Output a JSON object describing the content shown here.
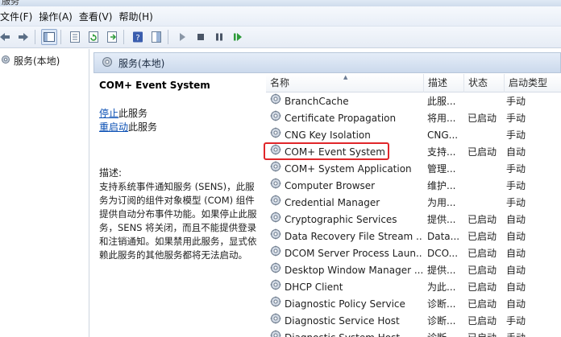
{
  "window": {
    "title": "服务"
  },
  "menu": [
    {
      "label": "文件(F)"
    },
    {
      "label": "操作(A)"
    },
    {
      "label": "查看(V)"
    },
    {
      "label": "帮助(H)"
    }
  ],
  "toolbar": [
    {
      "icon": "back-arrow-icon"
    },
    {
      "icon": "forward-arrow-icon"
    },
    {
      "icon": "show-hide-tree-icon"
    },
    {
      "icon": "properties-icon"
    },
    {
      "icon": "refresh-icon"
    },
    {
      "icon": "export-list-icon"
    },
    {
      "icon": "help-icon"
    },
    {
      "icon": "show-pane-icon"
    },
    {
      "icon": "start-service-icon"
    },
    {
      "icon": "stop-service-icon"
    },
    {
      "icon": "pause-service-icon"
    },
    {
      "icon": "restart-service-icon"
    }
  ],
  "tree": {
    "root_label": "服务(本地)"
  },
  "pane": {
    "header_label": "服务(本地)"
  },
  "description": {
    "service_name": "COM+ Event System",
    "stop_link": "停止",
    "stop_suffix": "此服务",
    "restart_link": "重启动",
    "restart_suffix": "此服务",
    "desc_label": "描述:",
    "desc_text": "支持系统事件通知服务 (SENS)，此服务为订阅的组件对象模型 (COM) 组件提供自动分布事件功能。如果停止此服务，SENS 将关闭，而且不能提供登录和注销通知。如果禁用此服务，显式依赖此服务的其他服务都将无法启动。"
  },
  "table": {
    "columns": {
      "name": "名称",
      "desc": "描述",
      "status": "状态",
      "startup": "启动类型"
    },
    "rows": [
      {
        "name": "BranchCache",
        "desc": "此服...",
        "status": "",
        "startup": "手动"
      },
      {
        "name": "Certificate Propagation",
        "desc": "将用...",
        "status": "已启动",
        "startup": "手动"
      },
      {
        "name": "CNG Key Isolation",
        "desc": "CNG...",
        "status": "",
        "startup": "手动"
      },
      {
        "name": "COM+ Event System",
        "desc": "支持...",
        "status": "已启动",
        "startup": "自动"
      },
      {
        "name": "COM+ System Application",
        "desc": "管理...",
        "status": "",
        "startup": "手动"
      },
      {
        "name": "Computer Browser",
        "desc": "维护...",
        "status": "",
        "startup": "手动"
      },
      {
        "name": "Credential Manager",
        "desc": "为用...",
        "status": "",
        "startup": "手动"
      },
      {
        "name": "Cryptographic Services",
        "desc": "提供...",
        "status": "已启动",
        "startup": "自动"
      },
      {
        "name": "Data Recovery File Stream ...",
        "desc": "Data...",
        "status": "已启动",
        "startup": "自动"
      },
      {
        "name": "DCOM Server Process Laun...",
        "desc": "DCO...",
        "status": "已启动",
        "startup": "自动"
      },
      {
        "name": "Desktop Window Manager ...",
        "desc": "提供...",
        "status": "已启动",
        "startup": "自动"
      },
      {
        "name": "DHCP Client",
        "desc": "为此...",
        "status": "已启动",
        "startup": "自动"
      },
      {
        "name": "Diagnostic Policy Service",
        "desc": "诊断...",
        "status": "已启动",
        "startup": "自动"
      },
      {
        "name": "Diagnostic Service Host",
        "desc": "诊断...",
        "status": "已启动",
        "startup": "手动"
      },
      {
        "name": "Diagnostic System Host",
        "desc": "诊断...",
        "status": "已启动",
        "startup": "手动"
      }
    ],
    "highlighted_row": "COM+ Event System",
    "highlight_color": "#e0262a"
  }
}
